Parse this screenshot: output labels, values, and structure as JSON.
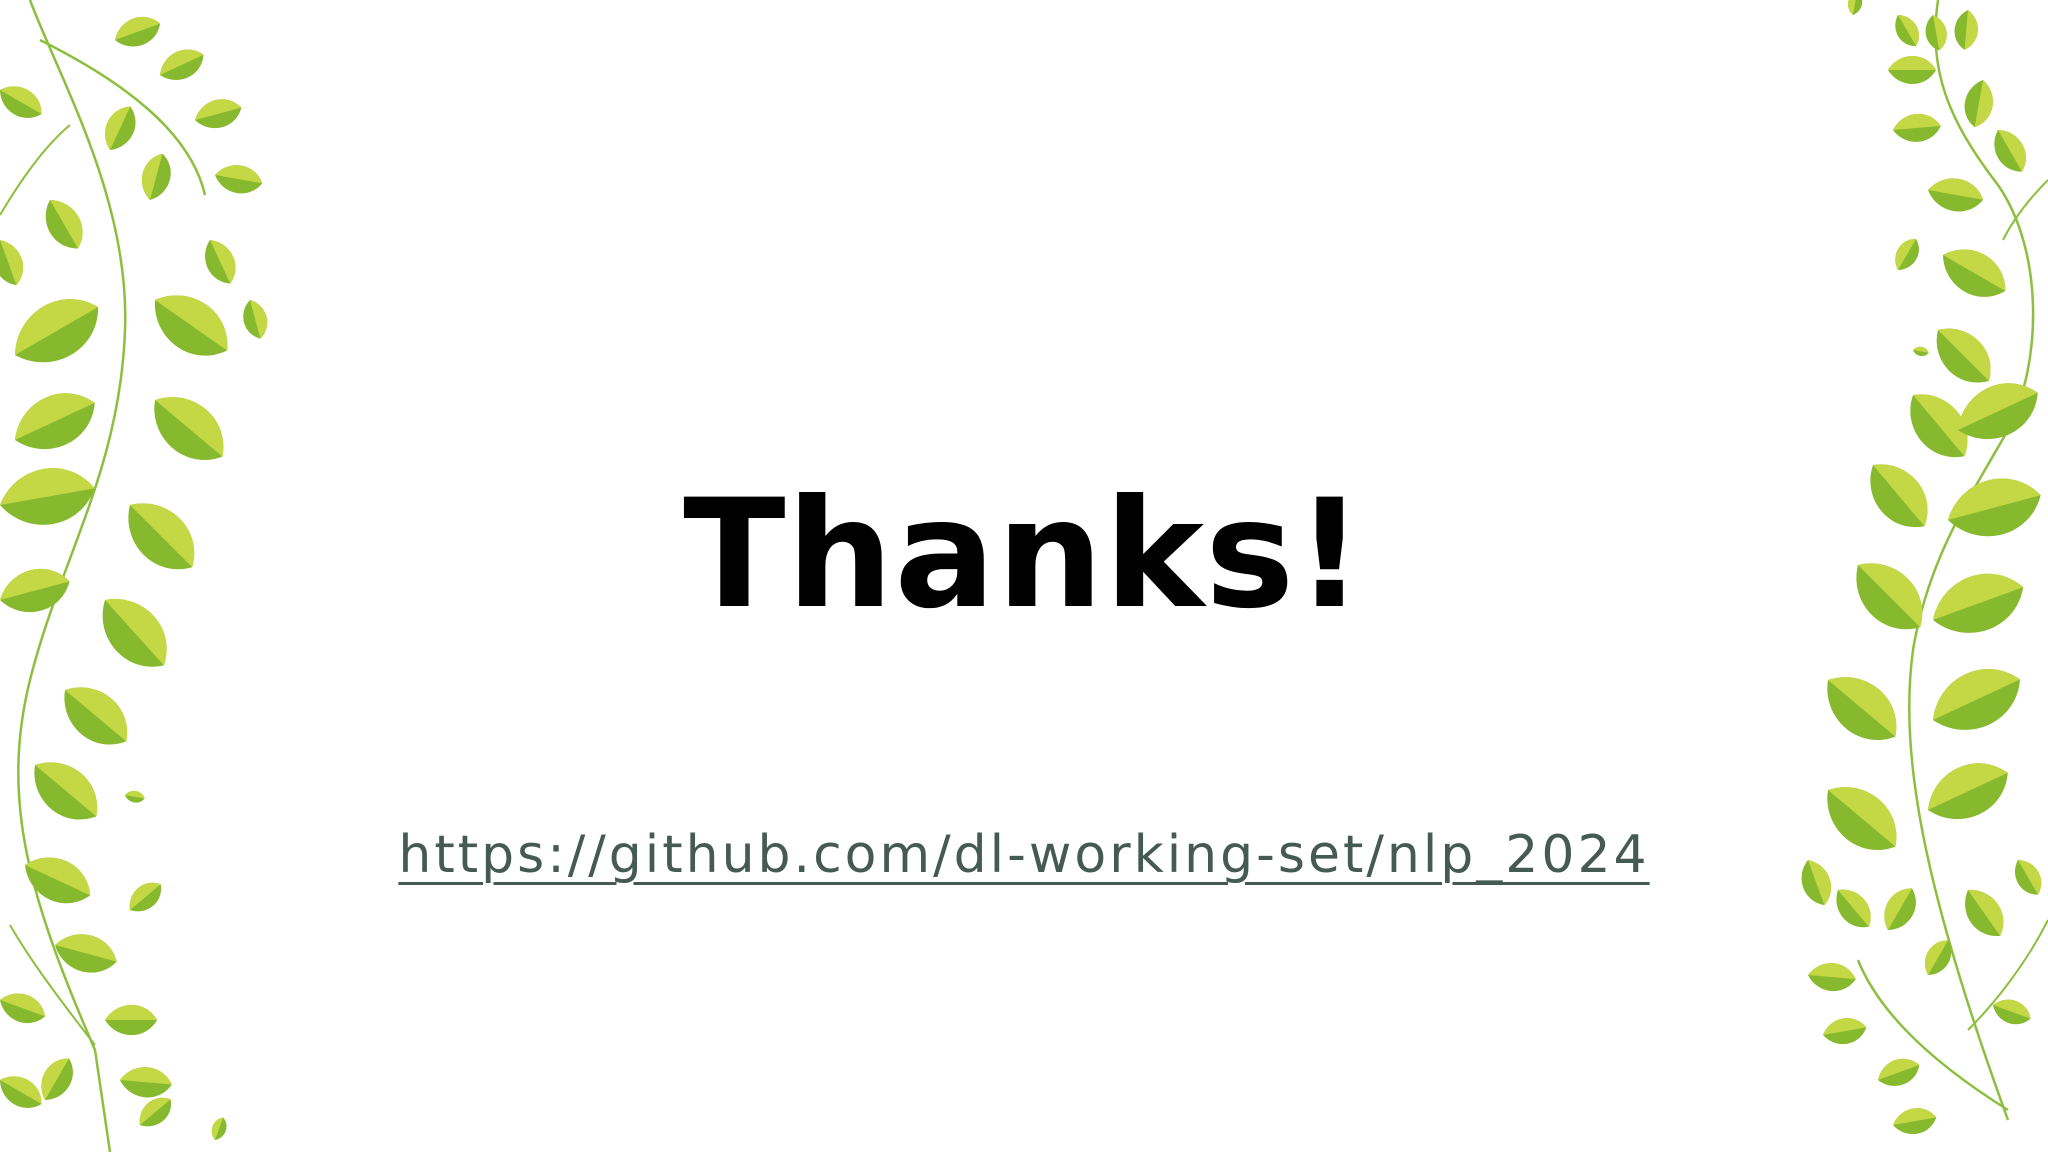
{
  "slide": {
    "title": "Thanks!",
    "link_text": "https://github.com/dl-working-set/nlp_2024"
  },
  "colors": {
    "background": "#ffffff",
    "title": "#000000",
    "link": "#455a52",
    "leaf_dark": "#86b92e",
    "leaf_light": "#c4d845",
    "stem": "#8cbf3f"
  },
  "decorations": {
    "left": "leaf-vine-left",
    "right": "leaf-vine-right"
  }
}
